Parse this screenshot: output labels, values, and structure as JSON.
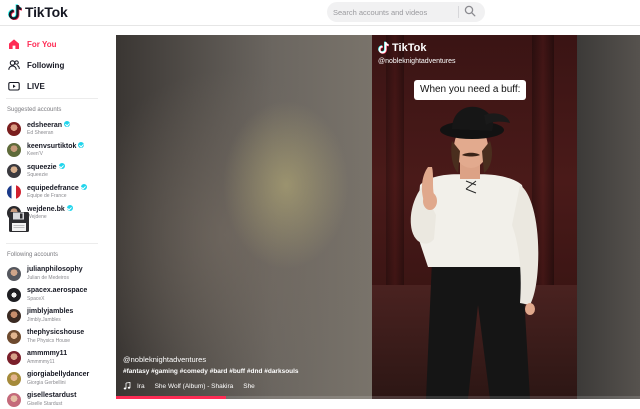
{
  "header": {
    "brand": "TikTok",
    "search_placeholder": "Search accounts and videos"
  },
  "nav": [
    {
      "label": "For You",
      "icon": "home-icon",
      "active": true
    },
    {
      "label": "Following",
      "icon": "users-icon",
      "active": false
    },
    {
      "label": "LIVE",
      "icon": "live-icon",
      "active": false
    }
  ],
  "suggested": {
    "title": "Suggested accounts",
    "accounts": [
      {
        "username": "edsheeran",
        "display": "Ed Sheeran",
        "verified": true
      },
      {
        "username": "keenvsurtiktok",
        "display": "Keen'V",
        "verified": true
      },
      {
        "username": "squeezie",
        "display": "Squeezie",
        "verified": true
      },
      {
        "username": "equipedefrance",
        "display": "Equipe de France",
        "verified": true
      },
      {
        "username": "wejdene.bk",
        "display": "Wejdene",
        "verified": true
      }
    ]
  },
  "following": {
    "title": "Following accounts",
    "accounts": [
      {
        "username": "julianphilosophy",
        "display": "Julian de Medeiros",
        "verified": false
      },
      {
        "username": "spacex.aerospace",
        "display": "SpaceX",
        "verified": false
      },
      {
        "username": "jimblyjambles",
        "display": "Jimbly.Jambles",
        "verified": false
      },
      {
        "username": "thephysicshouse",
        "display": "The Physics House",
        "verified": false
      },
      {
        "username": "ammmmy11",
        "display": "Ammmmy11",
        "verified": false
      },
      {
        "username": "giorgiabellydancer",
        "display": "Giorgia Gerbellini",
        "verified": false
      },
      {
        "username": "gisellestardust",
        "display": "Giselle Stardust",
        "verified": false
      }
    ]
  },
  "video": {
    "watermark_brand": "TikTok",
    "watermark_handle": "@nobleknightadventures",
    "caption": "When you need a buff:",
    "author": "@nobleknightadventures",
    "description": "#fantasy #gaming #comedy #bard #buff #dnd #darksouls",
    "music": [
      "Ira",
      "She Wolf (Album) - Shakira",
      "She"
    ],
    "progress_percent": 21
  },
  "colors": {
    "accent": "#fe2c55",
    "verified": "#20d5ec",
    "text": "#161823"
  }
}
